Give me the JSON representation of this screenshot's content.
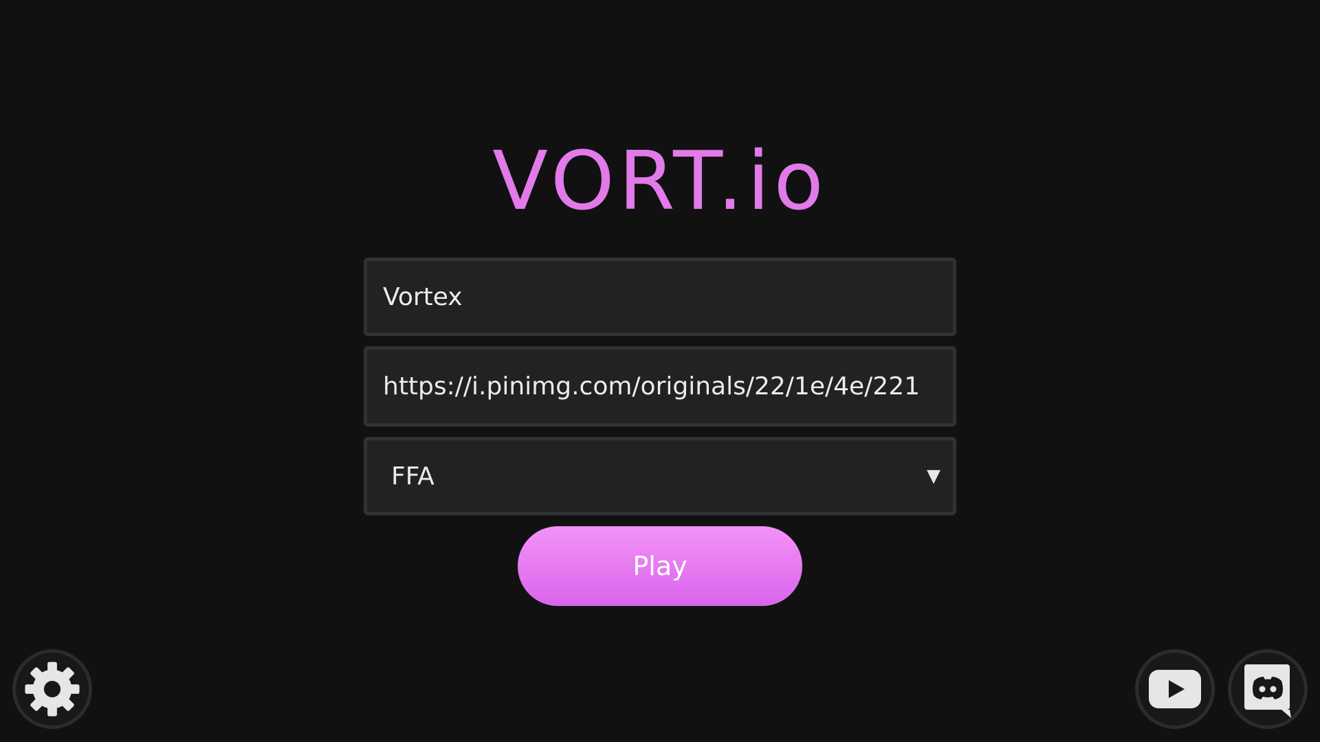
{
  "game": {
    "title": "VORT.io"
  },
  "menu": {
    "name_value": "Vortex",
    "skin_url_value": "https://i.pinimg.com/originals/22/1e/4e/221",
    "mode_selected": "FFA",
    "mode_arrow": "▼",
    "play_label": "Play"
  },
  "icons": {
    "settings": "gear-icon",
    "youtube": "youtube-icon",
    "discord": "discord-icon"
  },
  "colors": {
    "background": "#111112",
    "title": "#e27ae9",
    "play_button": "#e67bf1",
    "field_background": "#222223",
    "field_border": "#323234"
  }
}
